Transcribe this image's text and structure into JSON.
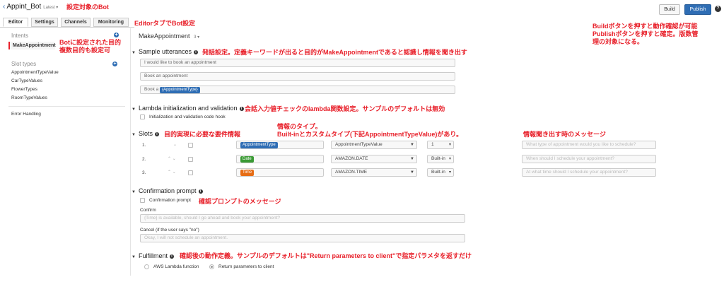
{
  "header": {
    "back_glyph": "‹",
    "bot_name": "Appint_Bot",
    "version_label": "Latest ▾",
    "build_label": "Build",
    "publish_label": "Publish",
    "help_glyph": "?"
  },
  "tabs": [
    {
      "label": "Editor",
      "active": true
    },
    {
      "label": "Settings",
      "active": false
    },
    {
      "label": "Channels",
      "active": false
    },
    {
      "label": "Monitoring",
      "active": false
    }
  ],
  "sidebar": {
    "intents_header": "Intents",
    "intents": [
      "MakeAppointment"
    ],
    "slot_types_header": "Slot types",
    "slot_types": [
      "AppointmentTypeValue",
      "CarTypeValues",
      "FlowerTypes",
      "RoomTypeValues"
    ],
    "error_handling": "Error Handling",
    "plus_glyph": "+"
  },
  "main": {
    "intent_name": "MakeAppointment",
    "intent_version": "3 ▾",
    "sample_utterances": {
      "title": "Sample utterances",
      "items": [
        "I would like to book an appointment",
        "Book an appointment"
      ],
      "third_prefix": "Book a",
      "third_slot": "{AppointmentType}"
    },
    "lambda": {
      "title": "Lambda initialization and validation",
      "checkbox_label": "Initialization and validation code hook"
    },
    "slots": {
      "title": "Slots",
      "rows": [
        {
          "num": "1.",
          "arrows": "⌄",
          "name": "AppointmentType",
          "type": "AppointmentTypeValue",
          "version": "1",
          "prompt": "What type of appointment would you like to schedule?",
          "color": "blue"
        },
        {
          "num": "2.",
          "arrows": "⌃ ⌄",
          "name": "Date",
          "type": "AMAZON.DATE",
          "version": "Built-in",
          "prompt": "When should I schedule your appointment?",
          "color": "green"
        },
        {
          "num": "3.",
          "arrows": "⌃ ⌄",
          "name": "Time",
          "type": "AMAZON.TIME",
          "version": "Built-in",
          "prompt": "At what time should I schedule your appointment?",
          "color": "orange"
        }
      ]
    },
    "confirmation": {
      "title": "Confirmation prompt",
      "checkbox_label": "Confirmation prompt",
      "confirm_label": "Confirm",
      "confirm_placeholder": "{Time} is available, should I go ahead and book your appointment?",
      "cancel_label": "Cancel (if the user says \"no\")",
      "cancel_placeholder": "Okay, I will not schedule an appointment."
    },
    "fulfillment": {
      "title": "Fulfillment",
      "option_lambda": "AWS Lambda function",
      "option_return": "Return parameters to client"
    }
  },
  "annotations": {
    "bot_target": "設定対象のBot",
    "editor_tab": "EditorタブでBot設定",
    "intents_1": "Botに設定された目的",
    "intents_2": "複数目的も設定可",
    "build_publish_1": "Buildボタンを押すと動作確認が可能",
    "build_publish_2": "Publishボタンを押すと確定。版数管",
    "build_publish_3": "理の対象になる。",
    "utterances": "発話設定。定義キーワードが出ると目的がMakeAppointmentであると認識し情報を聞き出す",
    "lambda": "会話入力値チェックのlambda関数設定。サンプルのデフォルトは無効",
    "slots_type_1": "情報のタイプ。",
    "slots_type_2": "Built-inとカスタムタイプ(下記AppointmentTypeValue)があり。",
    "slots": "目的実現に必要な要件情報",
    "prompt_msg": "情報聞き出す時のメッセージ",
    "confirm": "確認プロンプトのメッセージ",
    "fulfillment": "確認後の動作定義。サンプルのデフォルトは\"Return parameters to client\"で指定パラメタを返すだけ"
  },
  "colors": {
    "annotation": "#e8202a",
    "publish": "#2e6db4",
    "slot_blue": "#2e6db4",
    "slot_green": "#3a9a34",
    "slot_orange": "#e66c14"
  }
}
